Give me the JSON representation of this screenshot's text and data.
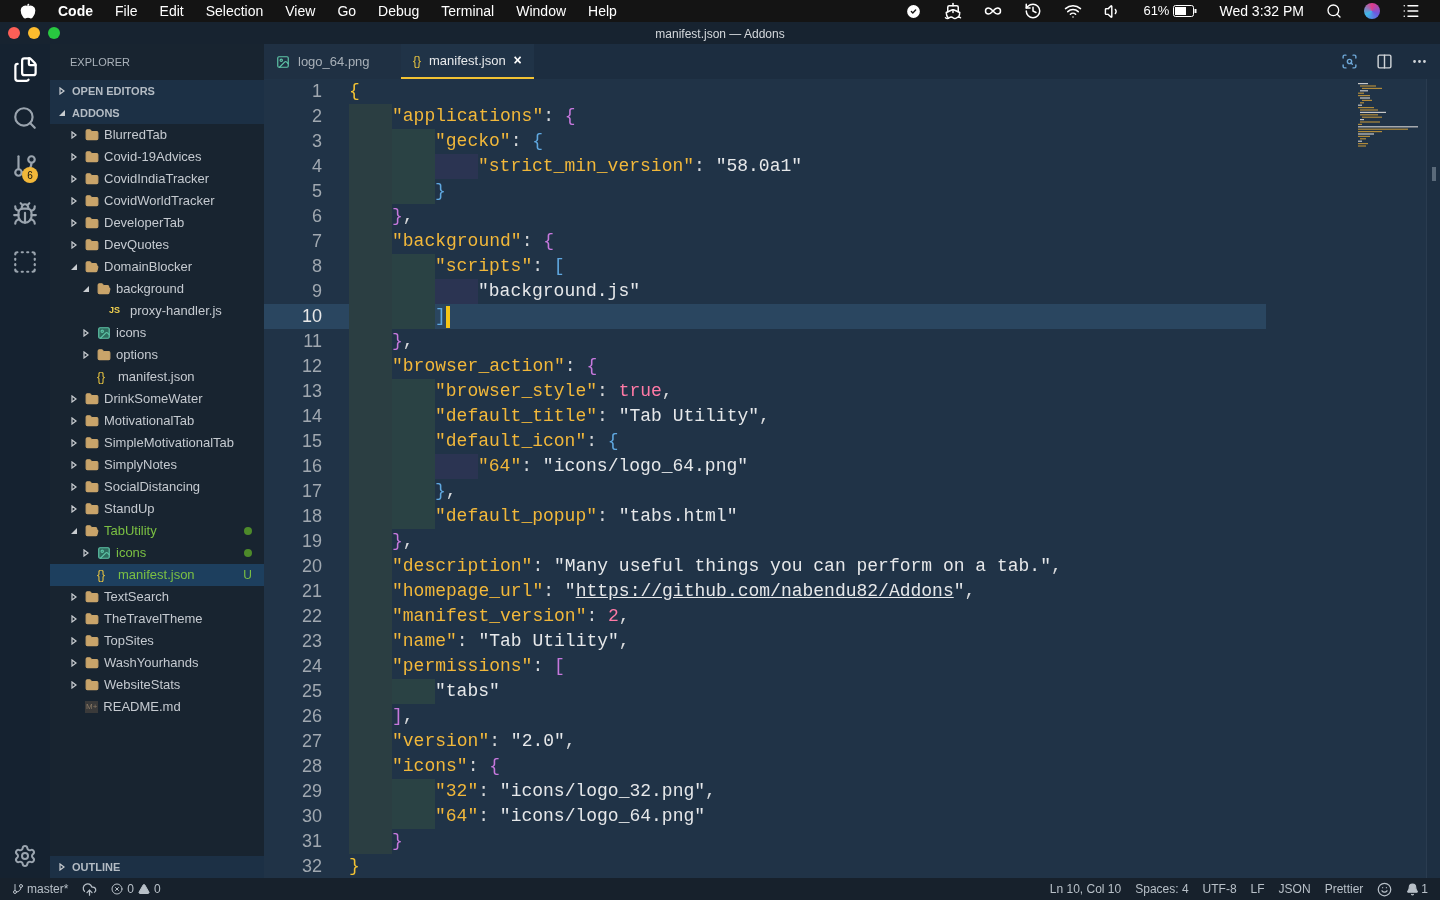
{
  "menu_bar": {
    "app": "Code",
    "items": [
      "File",
      "Edit",
      "Selection",
      "View",
      "Go",
      "Debug",
      "Terminal",
      "Window",
      "Help"
    ],
    "battery": "61%",
    "clock": "Wed 3:32 PM"
  },
  "window": {
    "title": "manifest.json — Addons"
  },
  "activity_bar": {
    "source_control_badge": "6"
  },
  "sidebar": {
    "title": "EXPLORER",
    "sections": [
      {
        "label": "OPEN EDITORS",
        "expanded": false
      },
      {
        "label": "ADDONS",
        "expanded": true
      }
    ],
    "tree": [
      {
        "name": "BlurredTab",
        "kind": "folder",
        "expanded": false
      },
      {
        "name": "Covid-19Advices",
        "kind": "folder",
        "expanded": false
      },
      {
        "name": "CovidIndiaTracker",
        "kind": "folder",
        "expanded": false
      },
      {
        "name": "CovidWorldTracker",
        "kind": "folder",
        "expanded": false
      },
      {
        "name": "DeveloperTab",
        "kind": "folder",
        "expanded": false
      },
      {
        "name": "DevQuotes",
        "kind": "folder",
        "expanded": false
      },
      {
        "name": "DomainBlocker",
        "kind": "folder",
        "expanded": true,
        "children": [
          {
            "name": "background",
            "kind": "folder",
            "expanded": true,
            "children": [
              {
                "name": "proxy-handler.js",
                "kind": "js",
                "icon_text": "JS"
              }
            ]
          },
          {
            "name": "icons",
            "kind": "image-folder",
            "expanded": false
          },
          {
            "name": "options",
            "kind": "folder",
            "expanded": false
          },
          {
            "name": "manifest.json",
            "kind": "json",
            "icon_text": "{}"
          }
        ]
      },
      {
        "name": "DrinkSomeWater",
        "kind": "folder",
        "expanded": false
      },
      {
        "name": "MotivationalTab",
        "kind": "folder",
        "expanded": false
      },
      {
        "name": "SimpleMotivationalTab",
        "kind": "folder",
        "expanded": false
      },
      {
        "name": "SimplyNotes",
        "kind": "folder",
        "expanded": false
      },
      {
        "name": "SocialDistancing",
        "kind": "folder",
        "expanded": false
      },
      {
        "name": "StandUp",
        "kind": "folder",
        "expanded": false
      },
      {
        "name": "TabUtility",
        "kind": "folder",
        "expanded": true,
        "changed": true,
        "dot": true,
        "children": [
          {
            "name": "icons",
            "kind": "image-folder",
            "expanded": false,
            "changed": true,
            "dot": true
          },
          {
            "name": "manifest.json",
            "kind": "json",
            "icon_text": "{}",
            "changed": true,
            "selected": true,
            "badge": "U"
          }
        ]
      },
      {
        "name": "TextSearch",
        "kind": "folder",
        "expanded": false
      },
      {
        "name": "TheTravelTheme",
        "kind": "folder",
        "expanded": false
      },
      {
        "name": "TopSites",
        "kind": "folder",
        "expanded": false
      },
      {
        "name": "WashYourhands",
        "kind": "folder",
        "expanded": false
      },
      {
        "name": "WebsiteStats",
        "kind": "folder",
        "expanded": false
      },
      {
        "name": "README.md",
        "kind": "markdown",
        "icon_text": "M+"
      }
    ],
    "outline": {
      "label": "OUTLINE",
      "expanded": false
    }
  },
  "tabs": [
    {
      "label": "logo_64.png",
      "kind": "image",
      "selected": false
    },
    {
      "label": "manifest.json",
      "kind": "json",
      "icon_text": "{}",
      "selected": true,
      "close": "×"
    }
  ],
  "editor": {
    "lines": [
      {
        "number": "1",
        "selected": false,
        "tokens": [
          {
            "kind": "brace",
            "text": "{",
            "color": "#f2c233"
          }
        ]
      },
      {
        "number": "2",
        "selected": false,
        "tokens": [
          {
            "kind": "indent"
          },
          {
            "kind": "key",
            "text": "\"applications\""
          },
          {
            "kind": "punct",
            "text": ": "
          },
          {
            "kind": "brace",
            "text": "{",
            "color": "#c678dd"
          }
        ]
      },
      {
        "number": "3",
        "selected": false,
        "tokens": [
          {
            "kind": "indent"
          },
          {
            "kind": "indent"
          },
          {
            "kind": "key",
            "text": "\"gecko\""
          },
          {
            "kind": "punct",
            "text": ": "
          },
          {
            "kind": "brace",
            "text": "{",
            "color": "#5fa8e0"
          }
        ]
      },
      {
        "number": "4",
        "selected": false,
        "tokens": [
          {
            "kind": "indent"
          },
          {
            "kind": "indent"
          },
          {
            "kind": "indent"
          },
          {
            "kind": "key",
            "text": "\"strict_min_version\""
          },
          {
            "kind": "punct",
            "text": ": "
          },
          {
            "kind": "string",
            "text": "\"58.0a1\""
          }
        ]
      },
      {
        "number": "5",
        "selected": false,
        "tokens": [
          {
            "kind": "indent"
          },
          {
            "kind": "indent"
          },
          {
            "kind": "brace",
            "text": "}",
            "color": "#5fa8e0"
          }
        ]
      },
      {
        "number": "6",
        "selected": false,
        "tokens": [
          {
            "kind": "indent"
          },
          {
            "kind": "brace",
            "text": "}",
            "color": "#c678dd"
          },
          {
            "kind": "punct",
            "text": ","
          }
        ]
      },
      {
        "number": "7",
        "selected": false,
        "tokens": [
          {
            "kind": "indent"
          },
          {
            "kind": "key",
            "text": "\"background\""
          },
          {
            "kind": "punct",
            "text": ": "
          },
          {
            "kind": "brace",
            "text": "{",
            "color": "#c678dd"
          }
        ]
      },
      {
        "number": "8",
        "selected": false,
        "tokens": [
          {
            "kind": "indent"
          },
          {
            "kind": "indent"
          },
          {
            "kind": "key",
            "text": "\"scripts\""
          },
          {
            "kind": "punct",
            "text": ": "
          },
          {
            "kind": "brace",
            "text": "[",
            "color": "#5fa8e0"
          }
        ]
      },
      {
        "number": "9",
        "selected": false,
        "tokens": [
          {
            "kind": "indent"
          },
          {
            "kind": "indent"
          },
          {
            "kind": "indent"
          },
          {
            "kind": "string",
            "text": "\"background.js\""
          }
        ]
      },
      {
        "number": "10",
        "selected": true,
        "tokens": [
          {
            "kind": "indent"
          },
          {
            "kind": "indent"
          },
          {
            "kind": "brace",
            "text": "]",
            "color": "#5fa8e0"
          }
        ]
      },
      {
        "number": "11",
        "selected": false,
        "tokens": [
          {
            "kind": "indent"
          },
          {
            "kind": "brace",
            "text": "}",
            "color": "#c678dd"
          },
          {
            "kind": "punct",
            "text": ","
          }
        ]
      },
      {
        "number": "12",
        "selected": false,
        "tokens": [
          {
            "kind": "indent"
          },
          {
            "kind": "key",
            "text": "\"browser_action\""
          },
          {
            "kind": "punct",
            "text": ": "
          },
          {
            "kind": "brace",
            "text": "{",
            "color": "#c678dd"
          }
        ]
      },
      {
        "number": "13",
        "selected": false,
        "tokens": [
          {
            "kind": "indent"
          },
          {
            "kind": "indent"
          },
          {
            "kind": "key",
            "text": "\"browser_style\""
          },
          {
            "kind": "punct",
            "text": ": "
          },
          {
            "kind": "literal",
            "text": "true"
          },
          {
            "kind": "punct",
            "text": ","
          }
        ]
      },
      {
        "number": "14",
        "selected": false,
        "tokens": [
          {
            "kind": "indent"
          },
          {
            "kind": "indent"
          },
          {
            "kind": "key",
            "text": "\"default_title\""
          },
          {
            "kind": "punct",
            "text": ": "
          },
          {
            "kind": "string",
            "text": "\"Tab Utility\""
          },
          {
            "kind": "punct",
            "text": ","
          }
        ]
      },
      {
        "number": "15",
        "selected": false,
        "tokens": [
          {
            "kind": "indent"
          },
          {
            "kind": "indent"
          },
          {
            "kind": "key",
            "text": "\"default_icon\""
          },
          {
            "kind": "punct",
            "text": ": "
          },
          {
            "kind": "brace",
            "text": "{",
            "color": "#5fa8e0"
          }
        ]
      },
      {
        "number": "16",
        "selected": false,
        "tokens": [
          {
            "kind": "indent"
          },
          {
            "kind": "indent"
          },
          {
            "kind": "indent"
          },
          {
            "kind": "key",
            "text": "\"64\""
          },
          {
            "kind": "punct",
            "text": ": "
          },
          {
            "kind": "string",
            "text": "\"icons/logo_64.png\""
          }
        ]
      },
      {
        "number": "17",
        "selected": false,
        "tokens": [
          {
            "kind": "indent"
          },
          {
            "kind": "indent"
          },
          {
            "kind": "brace",
            "text": "}",
            "color": "#5fa8e0"
          },
          {
            "kind": "punct",
            "text": ","
          }
        ]
      },
      {
        "number": "18",
        "selected": false,
        "tokens": [
          {
            "kind": "indent"
          },
          {
            "kind": "indent"
          },
          {
            "kind": "key",
            "text": "\"default_popup\""
          },
          {
            "kind": "punct",
            "text": ": "
          },
          {
            "kind": "string",
            "text": "\"tabs.html\""
          }
        ]
      },
      {
        "number": "19",
        "selected": false,
        "tokens": [
          {
            "kind": "indent"
          },
          {
            "kind": "brace",
            "text": "}",
            "color": "#c678dd"
          },
          {
            "kind": "punct",
            "text": ","
          }
        ]
      },
      {
        "number": "20",
        "selected": false,
        "tokens": [
          {
            "kind": "indent"
          },
          {
            "kind": "key",
            "text": "\"description\""
          },
          {
            "kind": "punct",
            "text": ": "
          },
          {
            "kind": "string",
            "text": "\"Many useful things you can perform on a tab.\""
          },
          {
            "kind": "punct",
            "text": ","
          }
        ]
      },
      {
        "number": "21",
        "selected": false,
        "tokens": [
          {
            "kind": "indent"
          },
          {
            "kind": "key",
            "text": "\"homepage_url\""
          },
          {
            "kind": "punct",
            "text": ": "
          },
          {
            "kind": "string",
            "text": "\""
          },
          {
            "kind": "link",
            "text": "https://github.com/nabendu82/Addons"
          },
          {
            "kind": "string",
            "text": "\""
          },
          {
            "kind": "punct",
            "text": ","
          }
        ]
      },
      {
        "number": "22",
        "selected": false,
        "tokens": [
          {
            "kind": "indent"
          },
          {
            "kind": "key",
            "text": "\"manifest_version\""
          },
          {
            "kind": "punct",
            "text": ": "
          },
          {
            "kind": "literal",
            "text": "2"
          },
          {
            "kind": "punct",
            "text": ","
          }
        ]
      },
      {
        "number": "23",
        "selected": false,
        "tokens": [
          {
            "kind": "indent"
          },
          {
            "kind": "key",
            "text": "\"name\""
          },
          {
            "kind": "punct",
            "text": ": "
          },
          {
            "kind": "string",
            "text": "\"Tab Utility\""
          },
          {
            "kind": "punct",
            "text": ","
          }
        ]
      },
      {
        "number": "24",
        "selected": false,
        "tokens": [
          {
            "kind": "indent"
          },
          {
            "kind": "key",
            "text": "\"permissions\""
          },
          {
            "kind": "punct",
            "text": ": "
          },
          {
            "kind": "brace",
            "text": "[",
            "color": "#c678dd"
          }
        ]
      },
      {
        "number": "25",
        "selected": false,
        "tokens": [
          {
            "kind": "indent"
          },
          {
            "kind": "indent"
          },
          {
            "kind": "string",
            "text": "\"tabs\""
          }
        ]
      },
      {
        "number": "26",
        "selected": false,
        "tokens": [
          {
            "kind": "indent"
          },
          {
            "kind": "brace",
            "text": "]",
            "color": "#c678dd"
          },
          {
            "kind": "punct",
            "text": ","
          }
        ]
      },
      {
        "number": "27",
        "selected": false,
        "tokens": [
          {
            "kind": "indent"
          },
          {
            "kind": "key",
            "text": "\"version\""
          },
          {
            "kind": "punct",
            "text": ": "
          },
          {
            "kind": "string",
            "text": "\"2.0\""
          },
          {
            "kind": "punct",
            "text": ","
          }
        ]
      },
      {
        "number": "28",
        "selected": false,
        "tokens": [
          {
            "kind": "indent"
          },
          {
            "kind": "key",
            "text": "\"icons\""
          },
          {
            "kind": "punct",
            "text": ": "
          },
          {
            "kind": "brace",
            "text": "{",
            "color": "#c678dd"
          }
        ]
      },
      {
        "number": "29",
        "selected": false,
        "tokens": [
          {
            "kind": "indent"
          },
          {
            "kind": "indent"
          },
          {
            "kind": "key",
            "text": "\"32\""
          },
          {
            "kind": "punct",
            "text": ": "
          },
          {
            "kind": "string",
            "text": "\"icons/logo_32.png\""
          },
          {
            "kind": "punct",
            "text": ","
          }
        ]
      },
      {
        "number": "30",
        "selected": false,
        "tokens": [
          {
            "kind": "indent"
          },
          {
            "kind": "indent"
          },
          {
            "kind": "key",
            "text": "\"64\""
          },
          {
            "kind": "punct",
            "text": ": "
          },
          {
            "kind": "string",
            "text": "\"icons/logo_64.png\""
          }
        ]
      },
      {
        "number": "31",
        "selected": false,
        "tokens": [
          {
            "kind": "indent"
          },
          {
            "kind": "brace",
            "text": "}",
            "color": "#c678dd"
          }
        ]
      },
      {
        "number": "32",
        "selected": false,
        "tokens": [
          {
            "kind": "brace",
            "text": "}",
            "color": "#f2c233"
          }
        ]
      }
    ]
  },
  "status_bar": {
    "branch": "master*",
    "errors": "0",
    "warnings": "0",
    "right": [
      "Ln 10, Col 10",
      "Spaces: 4",
      "UTF-8",
      "LF",
      "JSON",
      "Prettier"
    ],
    "notifications": "1"
  }
}
